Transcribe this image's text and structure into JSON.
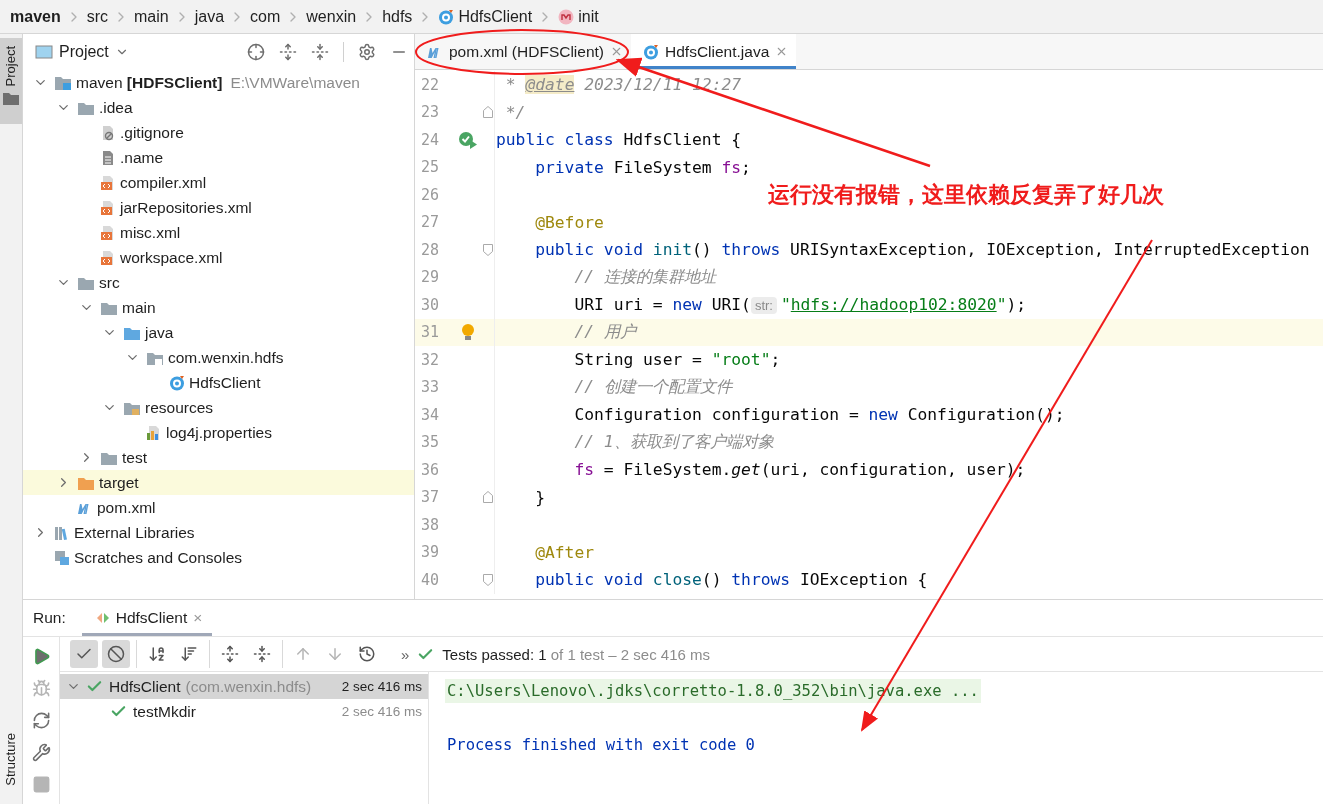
{
  "breadcrumb": [
    {
      "label": "maven",
      "kind": "module"
    },
    {
      "label": "src",
      "kind": "folder"
    },
    {
      "label": "main",
      "kind": "folder"
    },
    {
      "label": "java",
      "kind": "folder"
    },
    {
      "label": "com",
      "kind": "folder"
    },
    {
      "label": "wenxin",
      "kind": "folder"
    },
    {
      "label": "hdfs",
      "kind": "folder"
    },
    {
      "label": "HdfsClient",
      "kind": "class"
    },
    {
      "label": "init",
      "kind": "method"
    }
  ],
  "side_strip": {
    "top": "Project",
    "bottom": "Structure"
  },
  "project_panel": {
    "title": "Project",
    "tree": [
      {
        "label": "maven",
        "module": "[HDFSClient]",
        "path": "E:\\VMWare\\maven",
        "kind": "module",
        "expanded": true,
        "children": [
          {
            "label": ".idea",
            "kind": "folder",
            "expanded": true,
            "children": [
              {
                "label": ".gitignore",
                "kind": "ignore-file"
              },
              {
                "label": ".name",
                "kind": "text-file"
              },
              {
                "label": "compiler.xml",
                "kind": "xml-file"
              },
              {
                "label": "jarRepositories.xml",
                "kind": "xml-file"
              },
              {
                "label": "misc.xml",
                "kind": "xml-file"
              },
              {
                "label": "workspace.xml",
                "kind": "xml-file"
              }
            ]
          },
          {
            "label": "src",
            "kind": "folder",
            "expanded": true,
            "children": [
              {
                "label": "main",
                "kind": "folder",
                "expanded": true,
                "children": [
                  {
                    "label": "java",
                    "kind": "source-folder",
                    "expanded": true,
                    "children": [
                      {
                        "label": "com.wenxin.hdfs",
                        "kind": "package",
                        "expanded": true,
                        "children": [
                          {
                            "label": "HdfsClient",
                            "kind": "class"
                          }
                        ]
                      }
                    ]
                  },
                  {
                    "label": "resources",
                    "kind": "resources-folder",
                    "expanded": true,
                    "children": [
                      {
                        "label": "log4j.properties",
                        "kind": "properties"
                      }
                    ]
                  }
                ]
              },
              {
                "label": "test",
                "kind": "folder",
                "expanded": false
              }
            ]
          },
          {
            "label": "target",
            "kind": "excluded-folder",
            "expanded": false
          },
          {
            "label": "pom.xml",
            "kind": "maven"
          }
        ]
      },
      {
        "label": "External Libraries",
        "kind": "libraries",
        "expanded": false
      },
      {
        "label": "Scratches and Consoles",
        "kind": "scratches"
      }
    ]
  },
  "editor": {
    "tabs": [
      {
        "label": "pom.xml (HDFSClient)",
        "kind": "maven",
        "selected": false
      },
      {
        "label": "HdfsClient.java",
        "kind": "class",
        "selected": true
      }
    ],
    "lines": [
      {
        "number": "22",
        "current": false,
        "tokens": [
          {
            "kind": "comment",
            "s": " * "
          },
          {
            "kind": "tag",
            "s": "@date"
          },
          {
            "kind": "comment",
            "s": " 2023/12/11 12:27"
          }
        ]
      },
      {
        "number": "23",
        "current": false,
        "fold": {
          "kind": "close"
        },
        "tokens": [
          {
            "kind": "comment",
            "s": " */"
          }
        ]
      },
      {
        "number": "24",
        "current": false,
        "gutter": {
          "kind": "run"
        },
        "tokens": [
          {
            "kind": "kw",
            "s": "public class "
          },
          {
            "kind": "plain",
            "s": "HdfsClient {"
          }
        ]
      },
      {
        "number": "25",
        "current": false,
        "tokens": [
          {
            "kind": "kw",
            "s": "    private "
          },
          {
            "kind": "plain",
            "s": "FileSystem "
          },
          {
            "kind": "field",
            "s": "fs"
          },
          {
            "kind": "plain",
            "s": ";"
          }
        ]
      },
      {
        "number": "26",
        "current": false
      },
      {
        "number": "27",
        "current": false,
        "tokens": [
          {
            "kind": "annot",
            "s": "    @Before"
          }
        ]
      },
      {
        "number": "28",
        "current": false,
        "fold": {
          "kind": "open"
        },
        "tokens": [
          {
            "kind": "kw",
            "s": "    public void "
          },
          {
            "kind": "decl",
            "s": "init"
          },
          {
            "kind": "plain",
            "s": "() "
          },
          {
            "kind": "kw",
            "s": "throws "
          },
          {
            "kind": "plain",
            "s": "URISyntaxException, IOException, InterruptedException"
          }
        ]
      },
      {
        "number": "29",
        "current": false,
        "tokens": [
          {
            "kind": "comment",
            "s": "        // 连接的集群地址"
          }
        ]
      },
      {
        "number": "30",
        "current": false,
        "tokens": [
          {
            "kind": "plain",
            "s": "        URI uri = "
          },
          {
            "kind": "kw",
            "s": "new "
          },
          {
            "kind": "plain",
            "s": "URI("
          },
          {
            "kind": "hint",
            "s": "str:"
          },
          {
            "kind": "str",
            "s": "\""
          },
          {
            "kind": "url",
            "s": "hdfs://hadoop102:8020"
          },
          {
            "kind": "str",
            "s": "\""
          },
          {
            "kind": "plain",
            "s": ");"
          }
        ]
      },
      {
        "number": "31",
        "current": true,
        "gutter": {
          "kind": "bulb"
        },
        "tokens": [
          {
            "kind": "comment",
            "s": "        // 用户"
          }
        ]
      },
      {
        "number": "32",
        "current": false,
        "tokens": [
          {
            "kind": "plain",
            "s": "        String user = "
          },
          {
            "kind": "str",
            "s": "\"root\""
          },
          {
            "kind": "plain",
            "s": ";"
          }
        ]
      },
      {
        "number": "33",
        "current": false,
        "tokens": [
          {
            "kind": "comment",
            "s": "        // 创建一个配置文件"
          }
        ]
      },
      {
        "number": "34",
        "current": false,
        "tokens": [
          {
            "kind": "plain",
            "s": "        Configuration configuration = "
          },
          {
            "kind": "kw",
            "s": "new "
          },
          {
            "kind": "plain",
            "s": "Configuration();"
          }
        ]
      },
      {
        "number": "35",
        "current": false,
        "tokens": [
          {
            "kind": "comment",
            "s": "        // 1、获取到了客户端对象"
          }
        ]
      },
      {
        "number": "36",
        "current": false,
        "tokens": [
          {
            "kind": "field",
            "s": "        fs"
          },
          {
            "kind": "plain",
            "s": " = FileSystem."
          },
          {
            "kind": "static",
            "s": "get"
          },
          {
            "kind": "plain",
            "s": "(uri, configuration, user);"
          }
        ]
      },
      {
        "number": "37",
        "current": false,
        "fold": {
          "kind": "close"
        },
        "tokens": [
          {
            "kind": "plain",
            "s": "    }"
          }
        ]
      },
      {
        "number": "38",
        "current": false
      },
      {
        "number": "39",
        "current": false,
        "tokens": [
          {
            "kind": "annot",
            "s": "    @After"
          }
        ]
      },
      {
        "number": "40",
        "current": false,
        "fold": {
          "kind": "open"
        },
        "tokens": [
          {
            "kind": "kw",
            "s": "    public void "
          },
          {
            "kind": "decl",
            "s": "close"
          },
          {
            "kind": "plain",
            "s": "() "
          },
          {
            "kind": "kw",
            "s": "throws "
          },
          {
            "kind": "plain",
            "s": "IOException {"
          }
        ]
      }
    ]
  },
  "run_panel": {
    "label": "Run:",
    "tab": {
      "label": "HdfsClient",
      "close": "×"
    },
    "side_buttons": [
      {
        "kind": "run",
        "disabled": false
      },
      {
        "kind": "rerun-failed",
        "disabled": true
      },
      {
        "kind": "auto-test",
        "disabled": false
      },
      {
        "kind": "settings",
        "disabled": false
      },
      {
        "kind": "stop",
        "disabled": true
      }
    ],
    "toolbar": [
      [
        {
          "kind": "passed",
          "on": true,
          "disabled": false
        },
        {
          "kind": "ignored",
          "on": true,
          "disabled": false
        }
      ],
      [
        {
          "kind": "sort-alpha",
          "on": false,
          "disabled": false
        },
        {
          "kind": "sort-duration",
          "on": false,
          "disabled": false
        }
      ],
      [
        {
          "kind": "expand",
          "on": false,
          "disabled": false
        },
        {
          "kind": "collapse",
          "on": false,
          "disabled": false
        }
      ],
      [
        {
          "kind": "up",
          "on": false,
          "disabled": true
        },
        {
          "kind": "down",
          "on": false,
          "disabled": true
        },
        {
          "kind": "history",
          "on": false,
          "disabled": false
        }
      ]
    ],
    "status": {
      "more": "»",
      "passed": "Tests passed: 1",
      "detail": " of 1 test – 2 sec 416 ms"
    },
    "tests": [
      {
        "label": "HdfsClient",
        "package": "(com.wenxin.hdfs)",
        "time": "2 sec 416 ms",
        "selected": true,
        "expanded": true,
        "children": [
          {
            "label": "testMkdir",
            "time": "2 sec 416 ms",
            "selected": false
          }
        ]
      }
    ],
    "console": [
      {
        "kind": "command",
        "text": "C:\\Users\\Lenovo\\.jdks\\corretto-1.8.0_352\\bin\\java.exe ..."
      },
      {
        "kind": "blank"
      },
      {
        "kind": "system",
        "text": "Process finished with exit code 0"
      }
    ]
  },
  "annotation": {
    "text": "运行没有报错，这里依赖反复弄了好几次"
  }
}
